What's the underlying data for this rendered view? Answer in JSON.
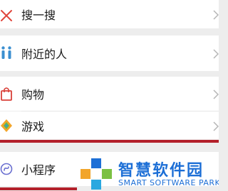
{
  "menu": {
    "items": [
      {
        "label": "搜一搜",
        "icon": "search-sparkle-icon"
      },
      {
        "label": "附近的人",
        "icon": "nearby-people-icon"
      },
      {
        "label": "购物",
        "icon": "shopping-bag-icon"
      },
      {
        "label": "游戏",
        "icon": "game-diamond-icon"
      },
      {
        "label": "小程序",
        "icon": "mini-program-icon"
      }
    ]
  },
  "watermark": {
    "cn": "智慧软件园",
    "en": "SMART SOFTWARE PARK"
  },
  "colors": {
    "highlight": "#b3202a",
    "watermark": "#1d6fd6",
    "background": "#ededed"
  }
}
